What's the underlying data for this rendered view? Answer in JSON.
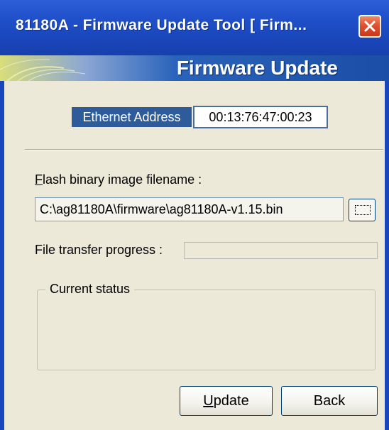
{
  "window": {
    "title": "81180A - Firmware Update Tool [ Firm...",
    "banner_title": "Firmware Update"
  },
  "ethernet": {
    "label": "Ethernet Address",
    "value": "00:13:76:47:00:23"
  },
  "flash": {
    "label_rest": "lash binary image filename :",
    "label_accel": "F",
    "path": "C:\\ag81180A\\firmware\\ag81180A-v1.15.bin",
    "browse_icon": "ellipsis-browse-icon"
  },
  "progress": {
    "label": "File transfer progress :",
    "value_percent": 0
  },
  "status": {
    "legend": "Current status",
    "text": ""
  },
  "buttons": {
    "update_accel": "U",
    "update_rest": "pdate",
    "back": "Back"
  },
  "colors": {
    "titlebar": "#1f4fc9",
    "eth_label_bg": "#2e5c9b",
    "close_red": "#e0512f",
    "dialog_bg": "#ece9d8"
  }
}
